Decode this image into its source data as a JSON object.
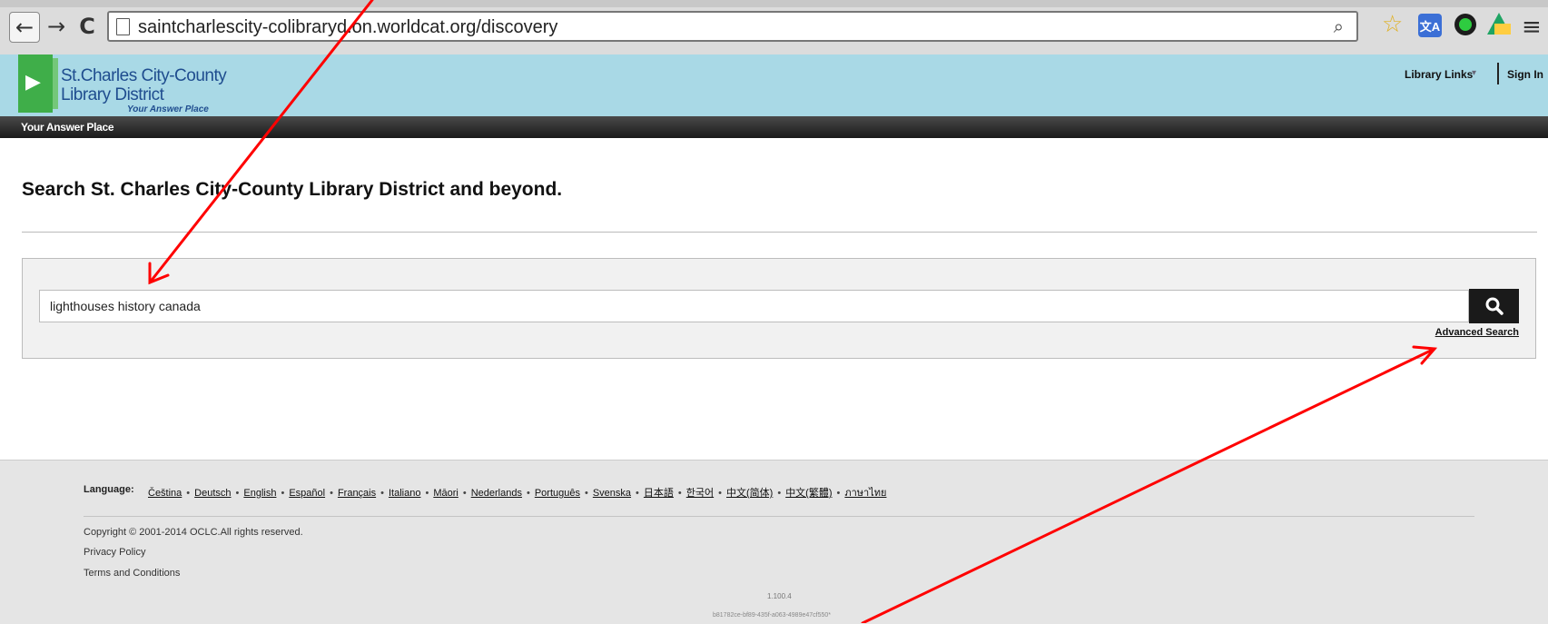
{
  "browser": {
    "url": "saintcharlescity-colibraryd.on.worldcat.org/discovery",
    "back_glyph": "←",
    "forward_glyph": "→",
    "reload_glyph": "C",
    "zoom_glyph": "⌕",
    "star_glyph": "☆",
    "menu_glyph": "≡",
    "translate_glyph": "文A"
  },
  "header": {
    "logo_line1": "St.Charles City-County",
    "logo_line2": "Library District",
    "logo_tagline": "Your Answer Place",
    "logo_glyph": "▶",
    "library_links": "Library Links",
    "library_links_arrow": "▾",
    "sign_in": "Sign In"
  },
  "nav_bar": {
    "text": "Your Answer Place"
  },
  "main": {
    "title": "Search St. Charles City-County Library District and beyond.",
    "search_value": "lighthouses history canada",
    "advanced_search": "Advanced Search"
  },
  "footer": {
    "language_label": "Language:",
    "languages": [
      "Čeština",
      "Deutsch",
      "English",
      "Español",
      "Français",
      "Italiano",
      "Māori",
      "Nederlands",
      "Português",
      "Svenska",
      "日本語",
      "한국어",
      "中文(简体)",
      "中文(繁體)",
      "ภาษาไทย"
    ],
    "separator": "•",
    "copyright": "Copyright © 2001-2014 OCLC.All rights reserved.",
    "privacy": "Privacy Policy",
    "terms": "Terms and Conditions",
    "version": "1.100.4",
    "build_id": "b81782ce-bf89-435f-a063-4989e47cf550*"
  },
  "colors": {
    "header_bg": "#a9d9e6",
    "logo_green": "#3fae49",
    "annotation_red": "#ff0000"
  }
}
